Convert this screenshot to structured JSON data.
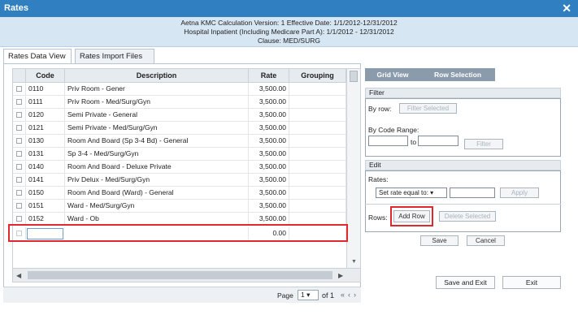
{
  "window": {
    "title": "Rates",
    "close_glyph": "✕"
  },
  "header": {
    "line1": "Aetna KMC Calculation Version: 1 Effective Date: 1/1/2012-12/31/2012",
    "line2": "Hospital Inpatient (Including Medicare Part A): 1/1/2012 - 12/31/2012",
    "line3": "Clause: MED/SURG"
  },
  "tabs": {
    "data_view": "Rates Data View",
    "import_files": "Rates Import Files"
  },
  "grid": {
    "columns": {
      "code": "Code",
      "description": "Description",
      "rate": "Rate",
      "grouping": "Grouping"
    },
    "rows": [
      {
        "code": "0110",
        "description": "Priv Room - Gener",
        "rate": "3,500.00",
        "grouping": ""
      },
      {
        "code": "0111",
        "description": "Priv Room - Med/Surg/Gyn",
        "rate": "3,500.00",
        "grouping": ""
      },
      {
        "code": "0120",
        "description": "Semi Private - General",
        "rate": "3,500.00",
        "grouping": ""
      },
      {
        "code": "0121",
        "description": "Semi Private - Med/Surg/Gyn",
        "rate": "3,500.00",
        "grouping": ""
      },
      {
        "code": "0130",
        "description": "Room And Board (Sp 3-4 Bd) - General",
        "rate": "3,500.00",
        "grouping": ""
      },
      {
        "code": "0131",
        "description": "Sp 3-4 - Med/Surg/Gyn",
        "rate": "3,500.00",
        "grouping": ""
      },
      {
        "code": "0140",
        "description": "Room And Board - Deluxe Private",
        "rate": "3,500.00",
        "grouping": ""
      },
      {
        "code": "0141",
        "description": "Priv Delux - Med/Surg/Gyn",
        "rate": "3,500.00",
        "grouping": ""
      },
      {
        "code": "0150",
        "description": "Room And Board (Ward) - General",
        "rate": "3,500.00",
        "grouping": ""
      },
      {
        "code": "0151",
        "description": "Ward - Med/Surg/Gyn",
        "rate": "3,500.00",
        "grouping": ""
      },
      {
        "code": "0152",
        "description": "Ward - Ob",
        "rate": "3,500.00",
        "grouping": ""
      }
    ],
    "new_row": {
      "code": "",
      "description": "",
      "rate": "0.00",
      "grouping": ""
    }
  },
  "pager": {
    "page_label": "Page",
    "page_value": "1",
    "of_label": "of 1"
  },
  "right_tabs": {
    "grid_view": "Grid View",
    "row_selection": "Row Selection"
  },
  "filter": {
    "title": "Filter",
    "by_row_label": "By row:",
    "filter_selected": "Filter Selected",
    "by_code_range_label": "By Code Range:",
    "to_label": "to",
    "filter_button": "Filter"
  },
  "edit": {
    "title": "Edit",
    "rates_label": "Rates:",
    "rate_option": "Set rate equal to:",
    "apply_button": "Apply",
    "rows_label": "Rows:",
    "add_row_button": "Add Row",
    "delete_selected_button": "Delete Selected",
    "save_button": "Save",
    "cancel_button": "Cancel"
  },
  "footer": {
    "save_exit_button": "Save and Exit",
    "exit_button": "Exit"
  },
  "colors": {
    "titlebar": "#2f7fc1",
    "header_bg": "#d7e6f3",
    "highlight": "#e0282e"
  }
}
